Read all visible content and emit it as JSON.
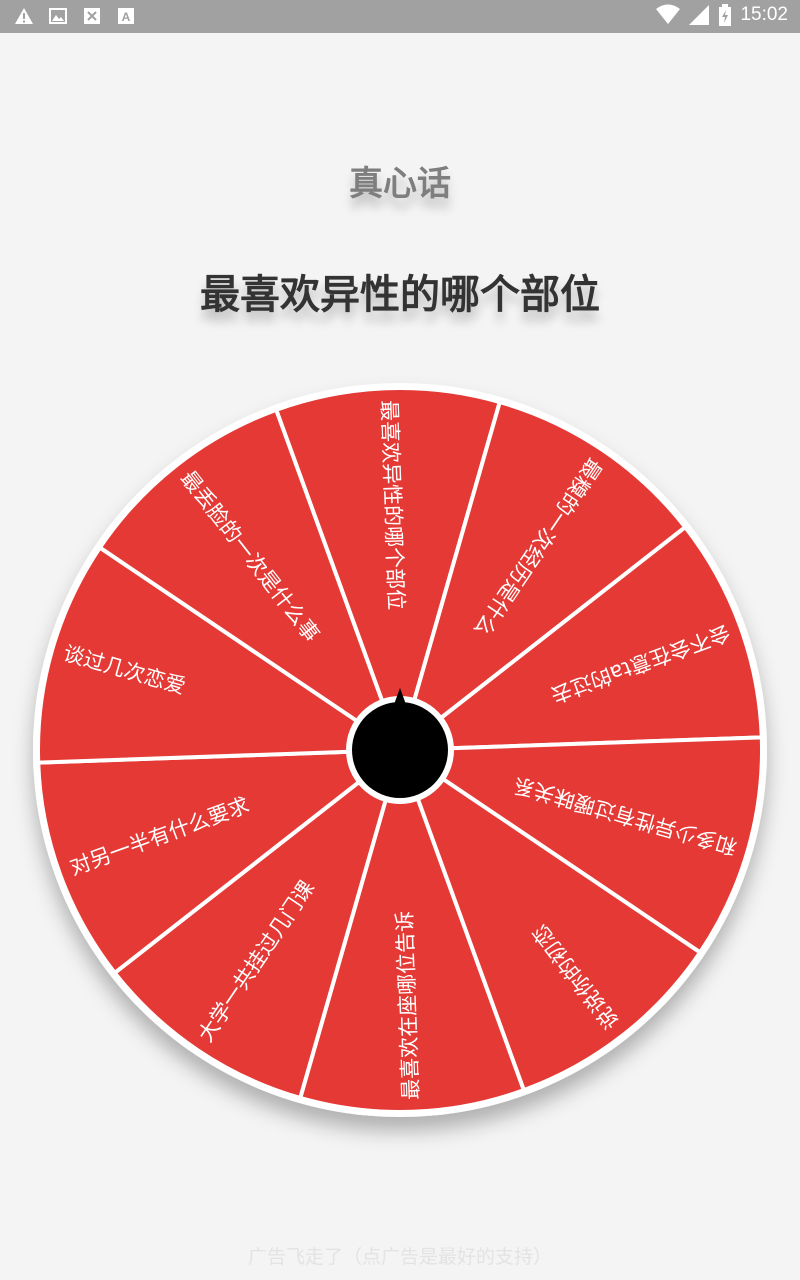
{
  "status_bar": {
    "left_icons": [
      "warning-icon",
      "image-icon",
      "no-signal-icon",
      "font-icon"
    ],
    "right_icons": [
      "wifi-icon",
      "signal-icon",
      "battery-icon"
    ],
    "time": "15:02"
  },
  "category": "真心话",
  "current_question": "最喜欢异性的哪个部位",
  "wheel": {
    "segment_color": "#e53935",
    "divider_color": "#ffffff",
    "hub_color": "#000000",
    "segments": [
      "最喜欢异性的哪个部位",
      "最糗的一次经历是什么",
      "会不会在意ta的过去",
      "和多少异性有过暧昧关系",
      "说说你的初恋",
      "最喜欢在座哪位告诉",
      "大学一共挂过几门课",
      "对另一半有什么要求",
      "谈过几次恋爱",
      "最丢脸的一次是什么事"
    ]
  },
  "footer_text": "广告飞走了（点广告是最好的支持）"
}
